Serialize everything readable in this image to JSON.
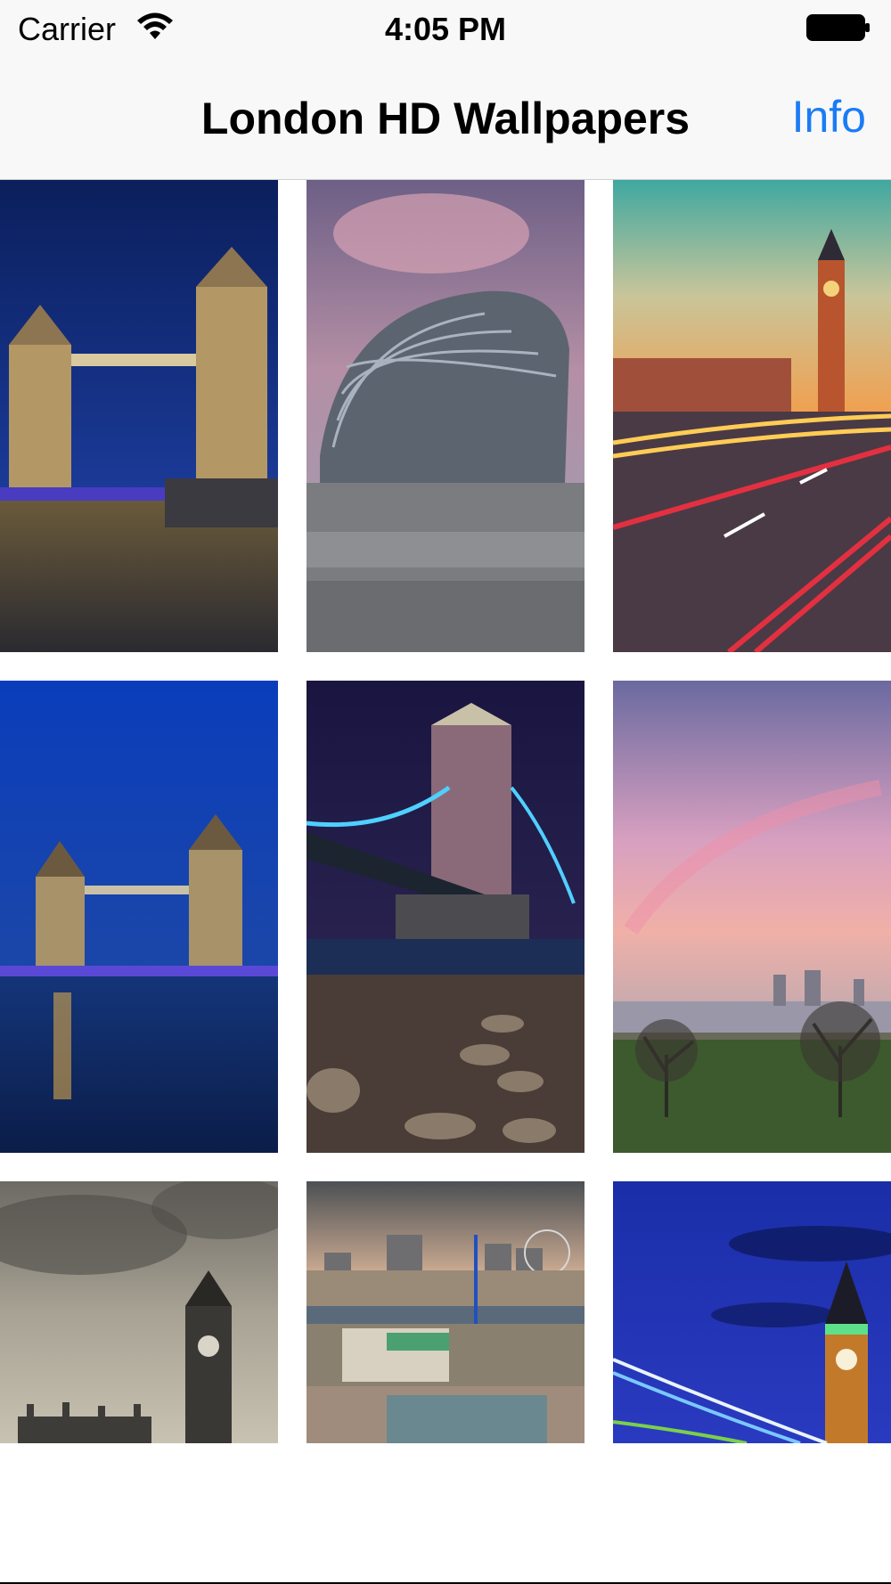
{
  "status_bar": {
    "carrier": "Carrier",
    "time": "4:05 PM",
    "wifi_icon": "wifi-icon",
    "battery_icon": "battery-icon"
  },
  "nav": {
    "title": "London HD Wallpapers",
    "info_label": "Info",
    "accent_color": "#1a7cf5"
  },
  "wallpapers": [
    {
      "subject": "tower-bridge-night"
    },
    {
      "subject": "city-hall-dome"
    },
    {
      "subject": "big-ben-light-trails-sunset"
    },
    {
      "subject": "tower-bridge-blue-hour"
    },
    {
      "subject": "tower-bridge-riverbank-stones"
    },
    {
      "subject": "greenwich-park-sunrise"
    },
    {
      "subject": "big-ben-sepia-clouds"
    },
    {
      "subject": "london-skyline-aerial"
    },
    {
      "subject": "big-ben-blue-night-trails"
    }
  ]
}
